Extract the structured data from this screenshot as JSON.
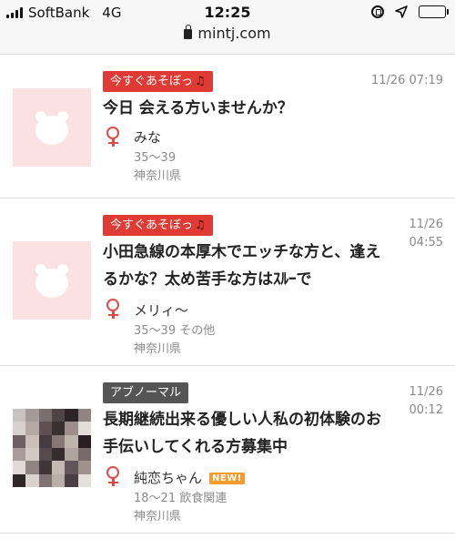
{
  "status_bar": {
    "carrier": "SoftBank",
    "network": "4G",
    "time": "12:25",
    "url": "mintj.com",
    "battery_level": 0.75
  },
  "posts": [
    {
      "tag": "今すぐあそぼっ",
      "tag_icon": "music-note-icon",
      "date_line1": "11/26 07:19",
      "date_line2": "",
      "title": "今日 会える方いませんか？",
      "name": "みな",
      "age": "35〜39",
      "region": "神奈川県",
      "badge": ""
    },
    {
      "tag": "今すぐあそぼっ",
      "tag_icon": "music-note-icon",
      "date_line1": "11/26",
      "date_line2": "04:55",
      "title_line1": "小田急線の本厚木でエッチな方と、逢え",
      "title_line2": "るかな？太め苦手な方はｽﾙｰで",
      "name": "メリィ〜",
      "age": "35〜39 その他",
      "region": "神奈川県",
      "badge": ""
    },
    {
      "tag": "アブノーマル",
      "date_line1": "11/26",
      "date_line2": "00:12",
      "title_line1": "長期継続出来る優しい人私の初体験のお",
      "title_line2": "手伝いしてくれる方募集中",
      "name": "純恋ちゃん",
      "badge": "NEW!",
      "age": "18〜21 飲食関連",
      "region": "神奈川県"
    }
  ],
  "colors": {
    "tag_red": "#e03a35",
    "tag_dark": "#555555",
    "female_icon": "#e04b45",
    "new_badge": "#f39b2c"
  }
}
